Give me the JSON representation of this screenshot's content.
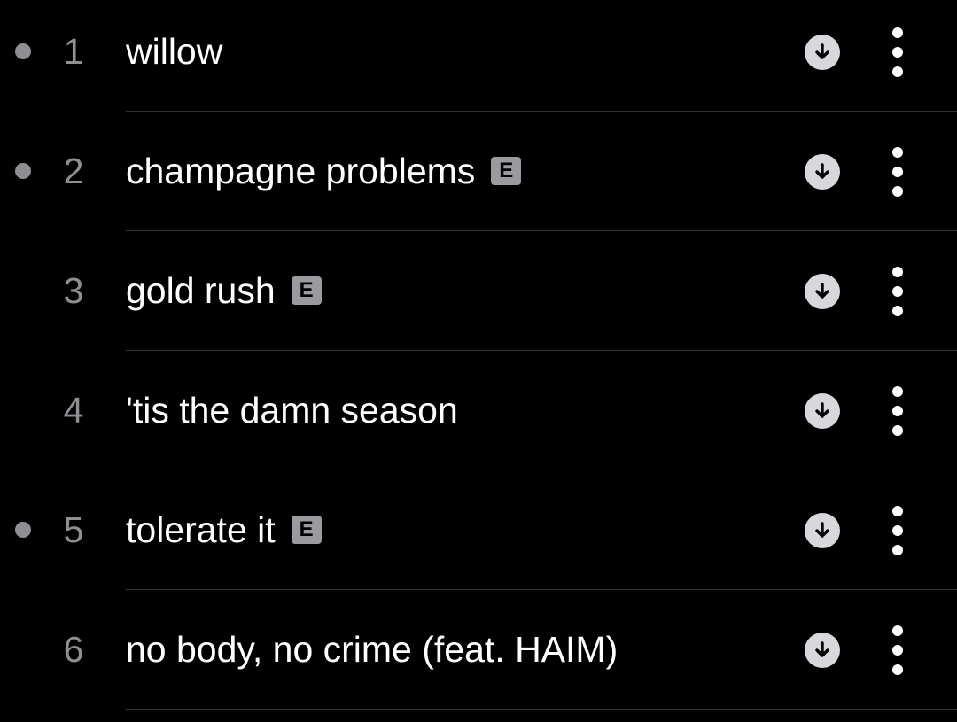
{
  "colors": {
    "background": "#000000",
    "title": "#ffffff",
    "number": "#8e8e93",
    "indicator_dot": "#8e8e93",
    "badge_bg": "#9a9a9f",
    "download_circle": "#d8d8dc",
    "separator": "#333336"
  },
  "icons": {
    "download": "download-arrow-circle-icon",
    "more": "vertical-ellipsis-icon"
  },
  "tracks": [
    {
      "number": "1",
      "title": "willow",
      "explicit": false,
      "explicit_label": "",
      "dot": true
    },
    {
      "number": "2",
      "title": "champagne problems",
      "explicit": true,
      "explicit_label": "E",
      "dot": true
    },
    {
      "number": "3",
      "title": "gold rush",
      "explicit": true,
      "explicit_label": "E",
      "dot": false
    },
    {
      "number": "4",
      "title": "'tis the damn season",
      "explicit": false,
      "explicit_label": "",
      "dot": false
    },
    {
      "number": "5",
      "title": "tolerate it",
      "explicit": true,
      "explicit_label": "E",
      "dot": true
    },
    {
      "number": "6",
      "title": "no body, no crime (feat. HAIM)",
      "explicit": false,
      "explicit_label": "",
      "dot": false
    }
  ]
}
